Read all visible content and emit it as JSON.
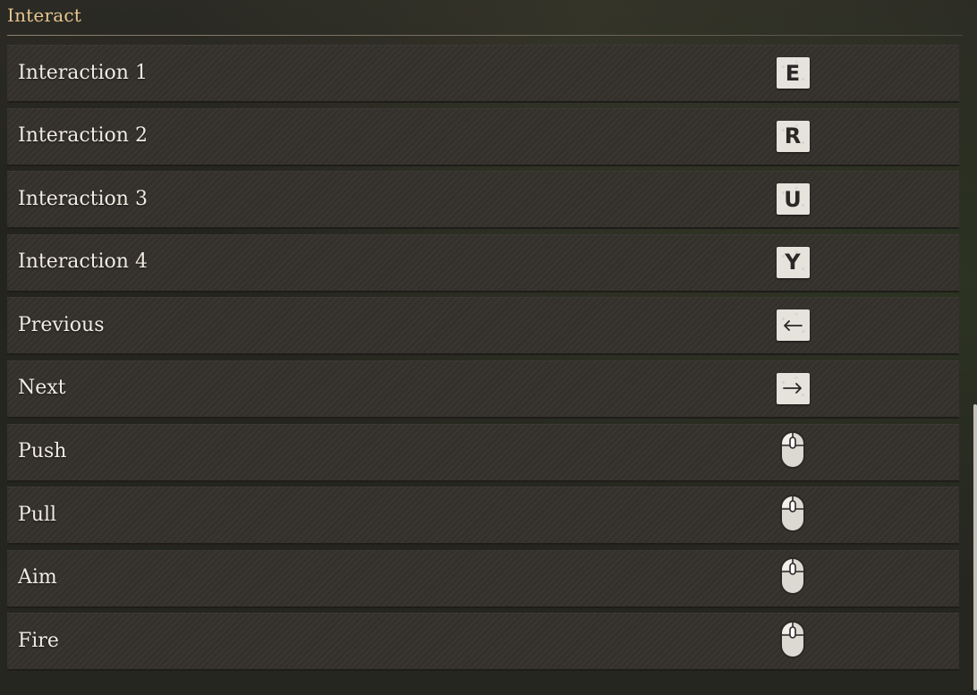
{
  "section": {
    "title": "Interact"
  },
  "bindings": [
    {
      "label": "Interaction  1",
      "key": "E",
      "icon": "key-e-icon",
      "type": "key"
    },
    {
      "label": "Interaction  2",
      "key": "R",
      "icon": "key-r-icon",
      "type": "key"
    },
    {
      "label": "Interaction  3",
      "key": "U",
      "icon": "key-u-icon",
      "type": "key"
    },
    {
      "label": "Interaction  4",
      "key": "Y",
      "icon": "key-y-icon",
      "type": "key"
    },
    {
      "label": "Previous",
      "key": "",
      "icon": "arrow-left-key-icon",
      "type": "arrow-left"
    },
    {
      "label": "Next",
      "key": "",
      "icon": "arrow-right-key-icon",
      "type": "arrow-right"
    },
    {
      "label": "Push",
      "key": "",
      "icon": "mouse-icon",
      "type": "mouse"
    },
    {
      "label": "Pull",
      "key": "",
      "icon": "mouse-icon",
      "type": "mouse"
    },
    {
      "label": "Aim",
      "key": "",
      "icon": "mouse-icon",
      "type": "mouse"
    },
    {
      "label": "Fire",
      "key": "",
      "icon": "mouse-icon",
      "type": "mouse"
    }
  ],
  "colors": {
    "title": "#e7c691",
    "row_bg": "#35322d",
    "label": "#f1ece2",
    "keycap": "#e6e2dc"
  }
}
